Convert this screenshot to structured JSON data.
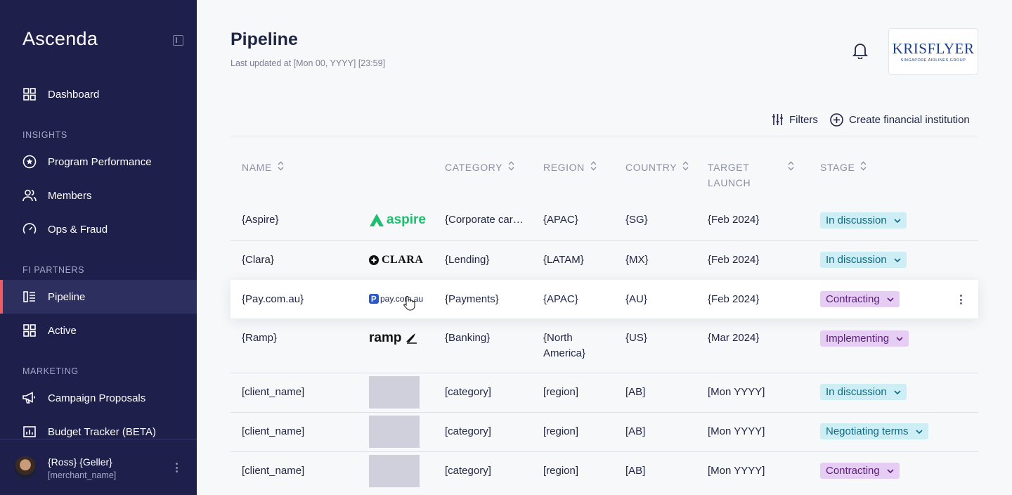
{
  "sidebar": {
    "brand": "Ascenda",
    "nav": [
      {
        "label": "Dashboard",
        "icon": "grid-icon"
      },
      {
        "label": "Program Performance",
        "icon": "star-circle-icon"
      },
      {
        "label": "Members",
        "icon": "users-icon"
      },
      {
        "label": "Ops & Fraud",
        "icon": "gauge-icon"
      },
      {
        "label": "Pipeline",
        "icon": "list-icon",
        "active": true
      },
      {
        "label": "Active",
        "icon": "grid-icon"
      },
      {
        "label": "Campaign Proposals",
        "icon": "megaphone-icon"
      },
      {
        "label": "Budget Tracker (BETA)",
        "icon": "chart-icon"
      }
    ],
    "sections": {
      "insights": "INSIGHTS",
      "fi_partners": "FI PARTNERS",
      "marketing": "MARKETING"
    },
    "user": {
      "name": "{Ross} {Geller}",
      "merchant": "[merchant_name]"
    }
  },
  "header": {
    "title": "Pipeline",
    "last_updated": "Last updated at [Mon 00, YYYY] [23:59]",
    "partner_logo": {
      "main": "KRISFLYER",
      "sub": "SINGAPORE AIRLINES GROUP"
    }
  },
  "toolbar": {
    "filters": "Filters",
    "create": "Create financial institution"
  },
  "table": {
    "columns": {
      "name": "NAME",
      "category": "CATEGORY",
      "region": "REGION",
      "country": "COUNTRY",
      "target_launch": "TARGET LAUNCH",
      "stage": "STAGE"
    },
    "rows": [
      {
        "name": "{Aspire}",
        "logo": "aspire",
        "category": "{Corporate car…",
        "region": "{APAC}",
        "country": "{SG}",
        "launch": "{Feb 2024}",
        "stage": "In discussion"
      },
      {
        "name": "{Clara}",
        "logo": "CLARA",
        "category": "{Lending}",
        "region": "{LATAM}",
        "country": "{MX}",
        "launch": "{Feb 2024}",
        "stage": "In discussion"
      },
      {
        "name": "{Pay.com.au}",
        "logo": "pay.com.au",
        "category": "{Payments}",
        "region": "{APAC}",
        "country": "{AU}",
        "launch": "{Feb 2024}",
        "stage": "Contracting"
      },
      {
        "name": "{Ramp}",
        "logo": "ramp",
        "category": "{Banking}",
        "region": "{North America}",
        "country": "{US}",
        "launch": "{Mar 2024}",
        "stage": "Implementing"
      },
      {
        "name": "[client_name]",
        "logo": "",
        "category": "[category]",
        "region": "[region]",
        "country": "[AB]",
        "launch": "[Mon YYYY]",
        "stage": "In discussion"
      },
      {
        "name": "[client_name]",
        "logo": "",
        "category": "[category]",
        "region": "[region]",
        "country": "[AB]",
        "launch": "[Mon YYYY]",
        "stage": "Negotiating terms"
      },
      {
        "name": "[client_name]",
        "logo": "",
        "category": "[category]",
        "region": "[region]",
        "country": "[AB]",
        "launch": "[Mon YYYY]",
        "stage": "Contracting"
      }
    ]
  },
  "colors": {
    "sidebar_bg": "#1e1f4b",
    "accent": "#f05a63",
    "discussion": "#cdeef4",
    "contracting": "#e6cdf3",
    "aspire_green": "#1fbe6e"
  }
}
